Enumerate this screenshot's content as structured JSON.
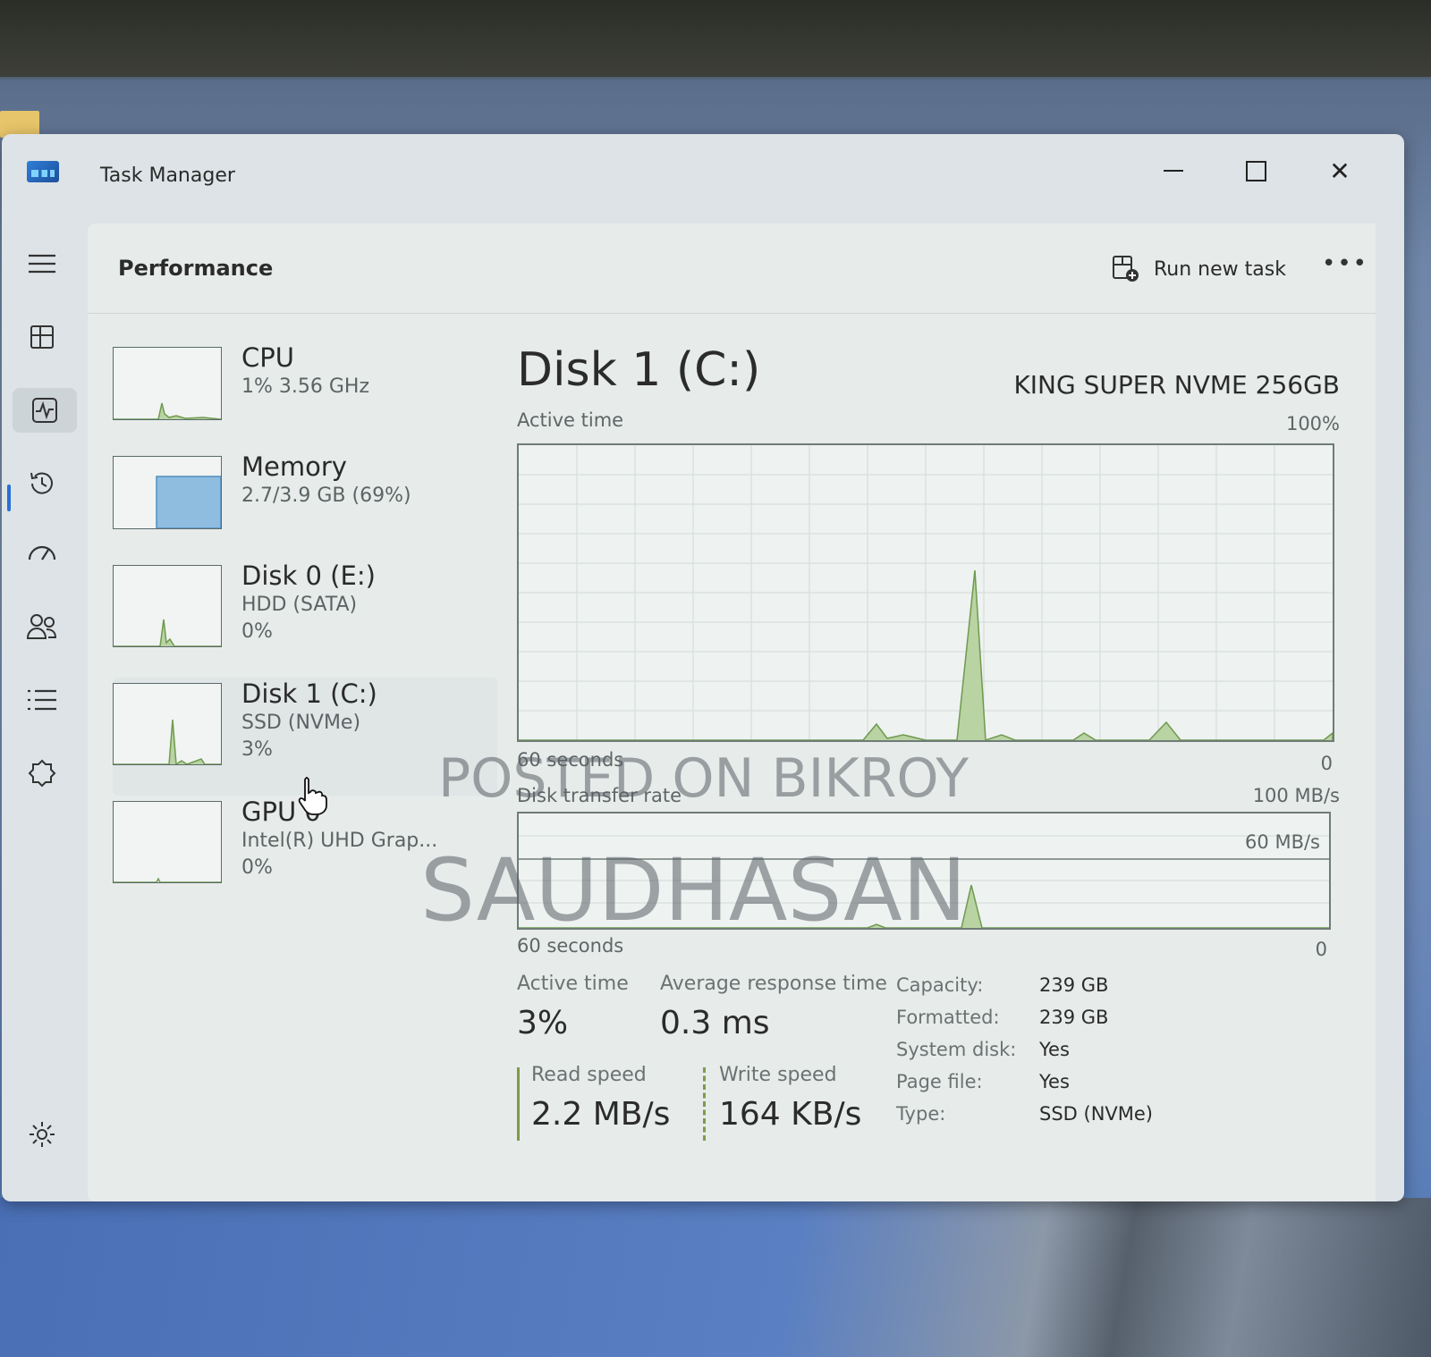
{
  "window": {
    "title": "Task Manager"
  },
  "header": {
    "title": "Performance",
    "run_task_label": "Run new task",
    "more_label": "•••"
  },
  "sidebar": {
    "items": [
      {
        "icon": "hamburger-icon"
      },
      {
        "icon": "processes-icon"
      },
      {
        "icon": "performance-icon"
      },
      {
        "icon": "app-history-icon"
      },
      {
        "icon": "startup-apps-icon"
      },
      {
        "icon": "users-icon"
      },
      {
        "icon": "details-icon"
      },
      {
        "icon": "services-icon"
      },
      {
        "icon": "settings-icon"
      }
    ]
  },
  "devices": [
    {
      "name": "CPU",
      "line1": "1% 3.56 GHz",
      "line2": ""
    },
    {
      "name": "Memory",
      "line1": "2.7/3.9 GB (69%)",
      "line2": ""
    },
    {
      "name": "Disk 0 (E:)",
      "line1": "HDD (SATA)",
      "line2": "0%"
    },
    {
      "name": "Disk 1 (C:)",
      "line1": "SSD (NVMe)",
      "line2": "3%"
    },
    {
      "name": "GPU 0",
      "line1": "Intel(R) UHD Grap...",
      "line2": "0%"
    }
  ],
  "detail": {
    "title": "Disk 1 (C:)",
    "model": "KING SUPER NVME 256GB",
    "active_time_chart": {
      "label": "Active time",
      "max": "100%",
      "x_left": "60 seconds",
      "x_right": "0"
    },
    "transfer_chart": {
      "label": "Disk transfer rate",
      "max": "100 MB/s",
      "ref_line": "60 MB/s",
      "x_left": "60 seconds",
      "x_right": "0"
    },
    "stats": {
      "active_time_label": "Active time",
      "active_time_value": "3%",
      "response_label": "Average response time",
      "response_value": "0.3 ms",
      "read_label": "Read speed",
      "read_value": "2.2 MB/s",
      "write_label": "Write speed",
      "write_value": "164 KB/s"
    },
    "properties": [
      {
        "k": "Capacity:",
        "v": "239 GB"
      },
      {
        "k": "Formatted:",
        "v": "239 GB"
      },
      {
        "k": "System disk:",
        "v": "Yes"
      },
      {
        "k": "Page file:",
        "v": "Yes"
      },
      {
        "k": "Type:",
        "v": "SSD (NVMe)"
      }
    ]
  },
  "watermark": {
    "line1": "POSTED ON BIKROY",
    "line2": "SAUDHASAN"
  },
  "colors": {
    "accent": "#2a6fd6",
    "graph_line": "#6f9a4f",
    "graph_fill": "#b9d3a3",
    "memory_fill": "#8fbde0"
  }
}
